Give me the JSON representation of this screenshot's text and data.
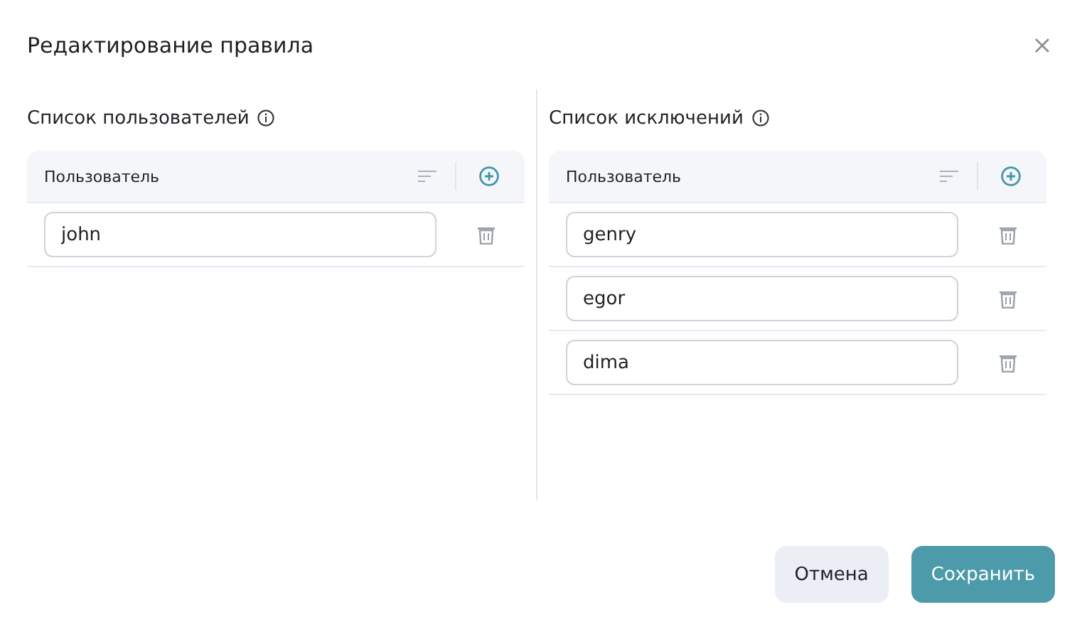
{
  "dialog": {
    "title": "Редактирование правила"
  },
  "lists": [
    {
      "title": "Список пользователей",
      "column": "Пользователь",
      "rows": [
        {
          "value": "john"
        }
      ]
    },
    {
      "title": "Список исключений",
      "column": "Пользователь",
      "rows": [
        {
          "value": "genry"
        },
        {
          "value": "egor"
        },
        {
          "value": "dima"
        }
      ]
    }
  ],
  "buttons": [
    {
      "label": "Отмена",
      "kind": "secondary"
    },
    {
      "label": "Сохранить",
      "kind": "primary"
    }
  ]
}
